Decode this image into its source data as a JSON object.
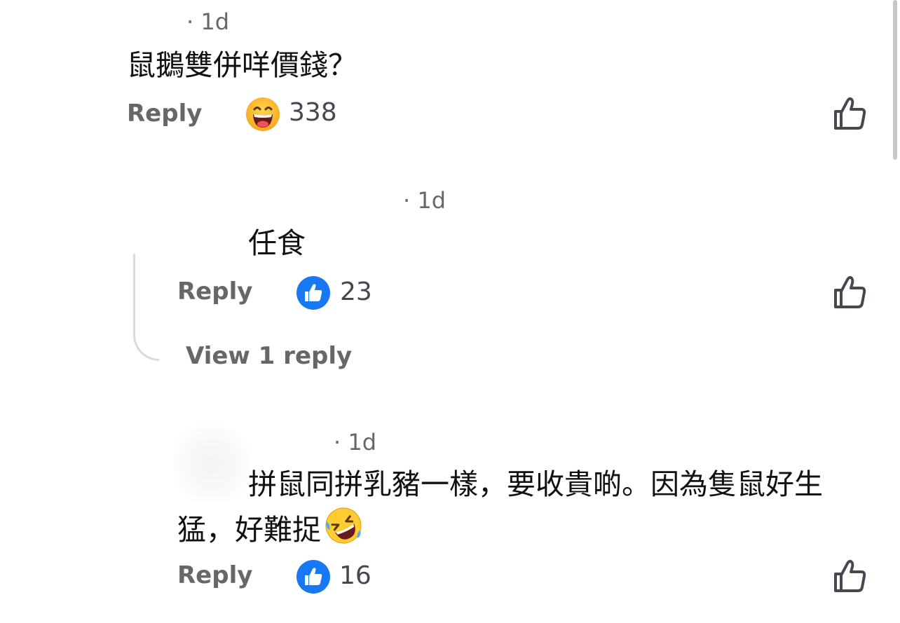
{
  "comments": [
    {
      "time": "· 1d",
      "text": "鼠鵝雙併咩價錢？",
      "reply_label": "Reply",
      "reaction_icon": "laughing-emoji",
      "reaction_count": "338"
    },
    {
      "time": "· 1d",
      "text": "任食",
      "reply_label": "Reply",
      "reaction_icon": "like-reaction",
      "reaction_count": "23",
      "view_replies_label": "View 1 reply"
    },
    {
      "time": "· 1d",
      "text_line1": "拼鼠同拼乳豬一樣，要收貴啲。因為隻鼠好生",
      "text_line2": "猛，好難捉",
      "text_emoji": "rolling-on-floor-laughing-emoji",
      "reply_label": "Reply",
      "reaction_icon": "like-reaction",
      "reaction_count": "16"
    }
  ],
  "colors": {
    "like_blue": "#1877f2",
    "meta_gray": "#65676b"
  }
}
